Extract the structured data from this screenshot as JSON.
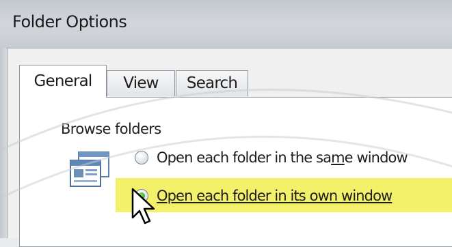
{
  "window": {
    "title": "Folder Options"
  },
  "tabs": [
    {
      "label": "General",
      "active": true
    },
    {
      "label": "View",
      "active": false
    },
    {
      "label": "Search",
      "active": false
    }
  ],
  "browse_folders": {
    "group_label": "Browse folders",
    "options": [
      {
        "label_pre": "Open each folder in the sa",
        "label_mnemonic": "m",
        "label_post": "e window",
        "selected": false
      },
      {
        "label_pre": "Open each folder in its own ",
        "label_mnemonic": "w",
        "label_post": "indow",
        "selected": true
      }
    ]
  },
  "icons": {
    "folder_view": "folder-window-icon",
    "cursor": "mouse-pointer-icon"
  },
  "colors": {
    "highlight": "#f3f06a",
    "radio_selected": "#1f8b17"
  }
}
